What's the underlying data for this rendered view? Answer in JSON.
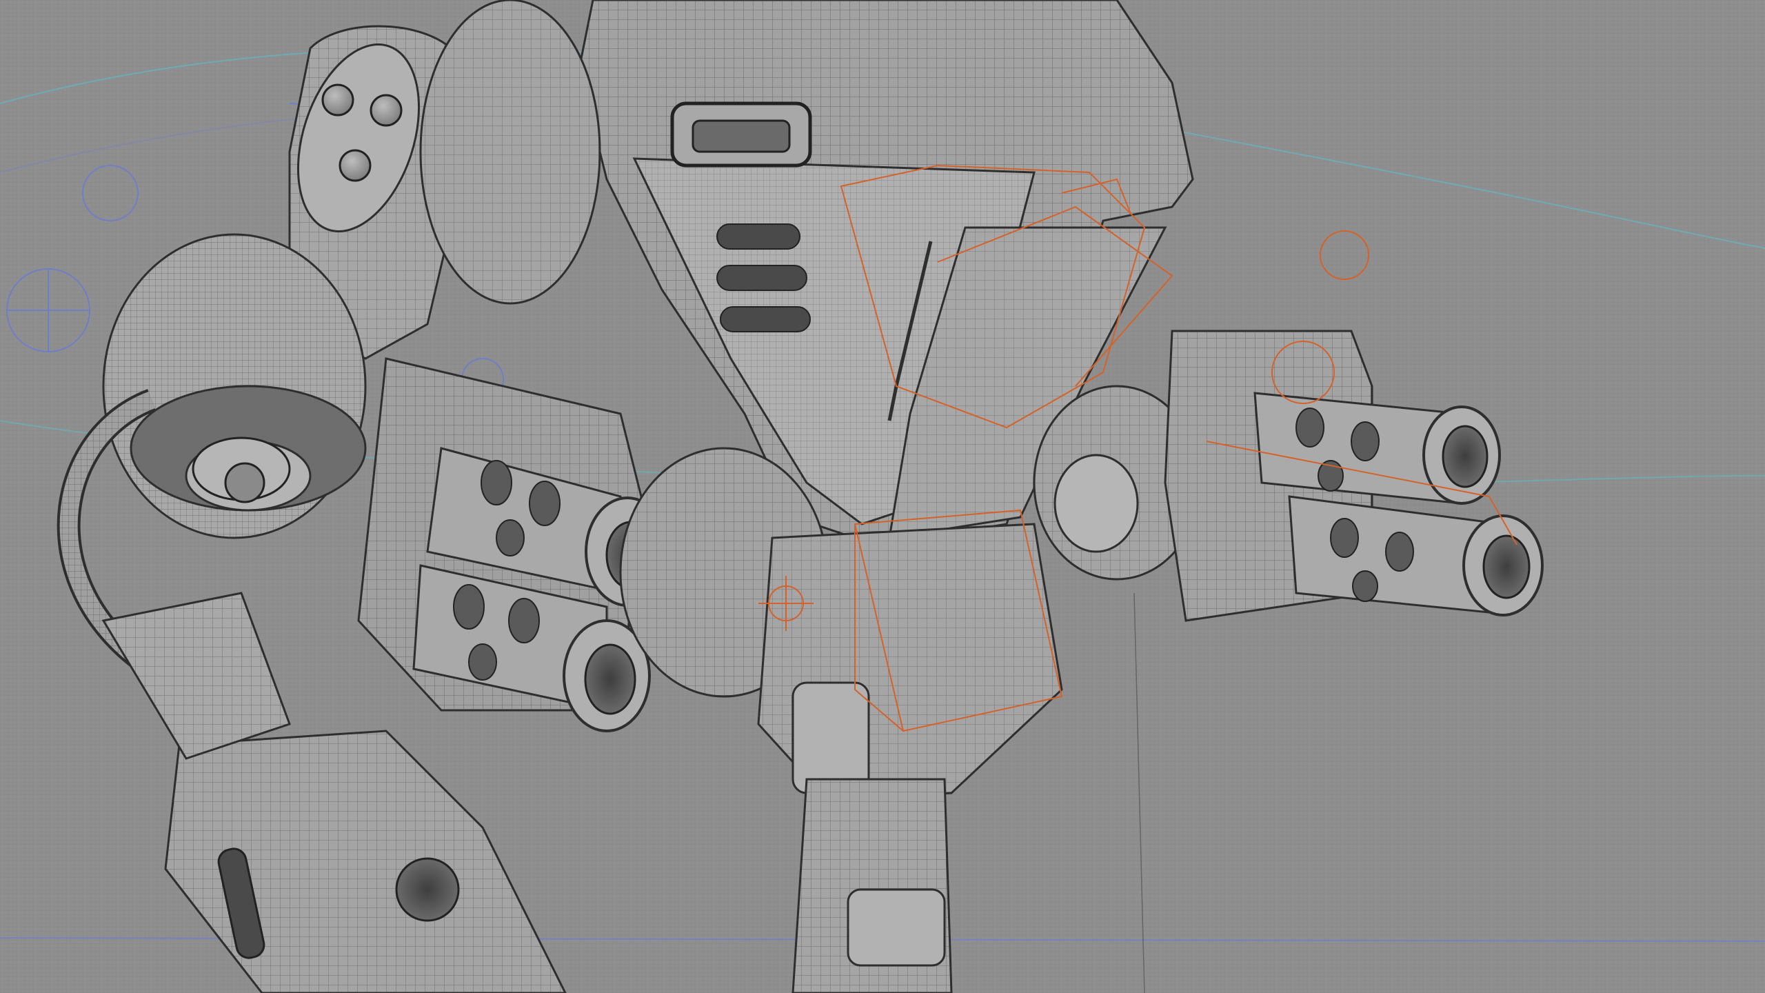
{
  "viewport": {
    "background": "#8f8f8f",
    "mesh_fill": "#9a9a9a",
    "mesh_shadow": "#6e6e6e",
    "mesh_light": "#b4b4b4",
    "wire_color": "#3a3a3a",
    "orange_rig": "#d4622a",
    "blue_rig": "#6e7fc8",
    "cyan_curve": "#5fb7c4"
  },
  "model": {
    "name_hidden": ""
  }
}
